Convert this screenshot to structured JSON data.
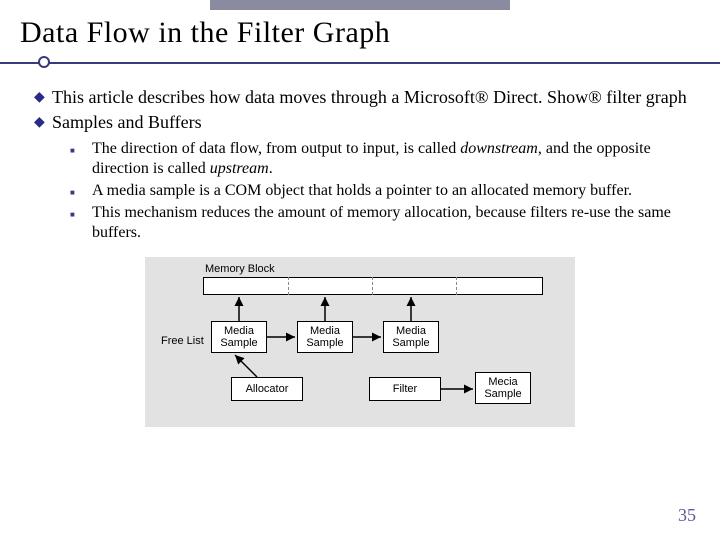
{
  "title": "Data Flow in the Filter Graph",
  "bullets": [
    {
      "text_a": "This article describes how data moves through a Microsoft",
      "reg1": "®",
      "text_b": " Direct. Show",
      "reg2": "®",
      "text_c": " filter graph"
    },
    {
      "text_a": "Samples and Buffers"
    }
  ],
  "subbullets": [
    {
      "pre": "The direction of data flow, from output to input, is called ",
      "em1": "downstream",
      "mid": ", and the opposite direction is called ",
      "em2": "upstream",
      "post": "."
    },
    {
      "pre": "A media sample is a COM object that holds a pointer to an allocated memory buffer."
    },
    {
      "pre": "This mechanism reduces the amount of memory allocation, because filters re-use the same buffers."
    }
  ],
  "diagram": {
    "memory_block": "Memory Block",
    "free_list": "Free List",
    "media_sample": "Media Sample",
    "allocator": "Allocator",
    "filter": "Filter",
    "mecia_sample": "Mecia Sample"
  },
  "page_number": "35"
}
